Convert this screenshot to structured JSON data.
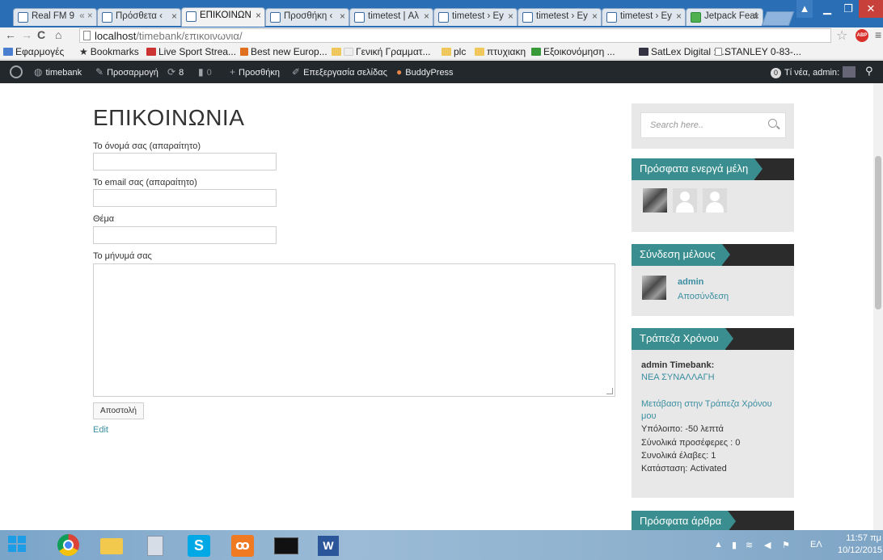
{
  "browser": {
    "tabs": [
      {
        "label": "Real FM 9",
        "extra": "« ×"
      },
      {
        "label": "Πρόσθετα ‹"
      },
      {
        "label": "ΕΠΙΚΟΙΝΩΝ"
      },
      {
        "label": "Προσθήκη ‹"
      },
      {
        "label": "timetest | Αλ"
      },
      {
        "label": "timetest › Ey"
      },
      {
        "label": "timetest › Ey"
      },
      {
        "label": "timetest › Ey"
      },
      {
        "label": "Jetpack Feat"
      }
    ],
    "url_host": "localhost",
    "url_path": "/timebank/επικοινωνια/"
  },
  "bookmarks": [
    "Εφαρμογές",
    "Bookmarks",
    "Live Sport Strea...",
    "Best new Europ...",
    "Γενική Γραμματ...",
    "plc",
    "πτυχιακη",
    "Εξοικονόμηση ...",
    "SatLex Digital :: ...",
    "STANLEY 0-83-..."
  ],
  "adminbar": {
    "site": "timebank",
    "customize": "Προσαρμογή",
    "updates": "8",
    "comments": "0",
    "new": "Προσθήκη",
    "edit": "Επεξεργασία σελίδας",
    "buddypress": "BuddyPress",
    "notif_count": "0",
    "greeting": "Τί νέα, admin"
  },
  "page": {
    "title": "ΕΠΙΚΟΙΝΩΝΙΑ",
    "name_label": "Το όνομά σας (απαραίτητο)",
    "email_label": "Το email σας (απαραίτητο)",
    "subject_label": "Θέμα",
    "message_label": "Το μήνυμά σας",
    "submit": "Αποστολή",
    "edit": "Edit"
  },
  "sidebar": {
    "search_placeholder": "Search here..",
    "recent_members_title": "Πρόσφατα ενεργά μέλη",
    "login_title": "Σύνδεση μέλους",
    "user_name": "admin",
    "logout": "Αποσύνδεση",
    "timebank_title": "Τράπεζα Χρόνου",
    "timebank_user": "admin Timebank:",
    "new_exchange": "ΝΕΑ ΣΥΝΑΛΛΑΓΗ",
    "goto_line1": "Μετάβαση στην Τράπεζα Χρόνου",
    "goto_line2": "μου",
    "balance": "Υπόλοιπο: -50 λεπτά",
    "total_offers": "Σύνολικά προσέφερες : 0",
    "total_received": "Συνολικά έλαβες: 1",
    "status": "Κατάσταση: Activated",
    "recent_posts_title": "Πρόσφατα άρθρα"
  },
  "taskbar": {
    "lang": "ΕΛ",
    "time": "11:57 πμ",
    "date": "10/12/2015"
  }
}
